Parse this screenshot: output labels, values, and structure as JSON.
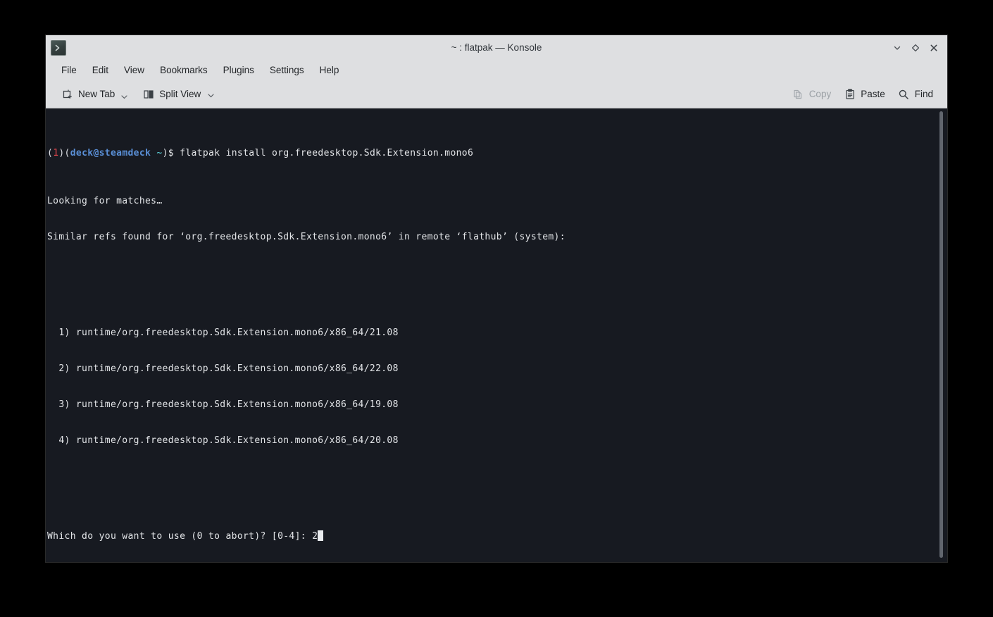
{
  "window": {
    "title": "~ : flatpak — Konsole",
    "app_icon": "terminal-prompt-icon",
    "controls": {
      "minimize": "minimize-icon",
      "maximize": "maximize-icon",
      "close": "close-icon"
    }
  },
  "menubar": {
    "items": [
      {
        "label": "File"
      },
      {
        "label": "Edit"
      },
      {
        "label": "View"
      },
      {
        "label": "Bookmarks"
      },
      {
        "label": "Plugins"
      },
      {
        "label": "Settings"
      },
      {
        "label": "Help"
      }
    ]
  },
  "toolbar": {
    "left": [
      {
        "label": "New Tab",
        "icon": "new-tab-icon",
        "has_menu": true,
        "enabled": true
      },
      {
        "label": "Split View",
        "icon": "split-view-icon",
        "has_menu": true,
        "enabled": true
      }
    ],
    "right": [
      {
        "label": "Copy",
        "icon": "copy-icon",
        "enabled": false
      },
      {
        "label": "Paste",
        "icon": "paste-icon",
        "enabled": true
      },
      {
        "label": "Find",
        "icon": "search-icon",
        "enabled": true
      }
    ]
  },
  "terminal": {
    "prompt": {
      "jobs_count": "1",
      "user_host": "deck@steamdeck",
      "cwd": "~",
      "symbol": "$"
    },
    "command": "flatpak install org.freedesktop.Sdk.Extension.mono6",
    "output_lines": [
      "Looking for matches…",
      "Similar refs found for ‘org.freedesktop.Sdk.Extension.mono6’ in remote ‘flathub’ (system):"
    ],
    "choices": [
      "  1) runtime/org.freedesktop.Sdk.Extension.mono6/x86_64/21.08",
      "  2) runtime/org.freedesktop.Sdk.Extension.mono6/x86_64/22.08",
      "  3) runtime/org.freedesktop.Sdk.Extension.mono6/x86_64/19.08",
      "  4) runtime/org.freedesktop.Sdk.Extension.mono6/x86_64/20.08"
    ],
    "question": "Which do you want to use (0 to abort)? [0-4]: ",
    "typed_answer": "2"
  },
  "colors": {
    "desktop_background": "#000000",
    "window_chrome": "#dedfe1",
    "terminal_background": "#171a21",
    "terminal_foreground": "#e3e5e8",
    "prompt_job_number": "#e8484e",
    "prompt_user_host": "#5a8fd6",
    "prompt_cwd": "#5fd7e0",
    "cursor": "#e9ebee",
    "scrollbar_thumb": "#61666e"
  }
}
